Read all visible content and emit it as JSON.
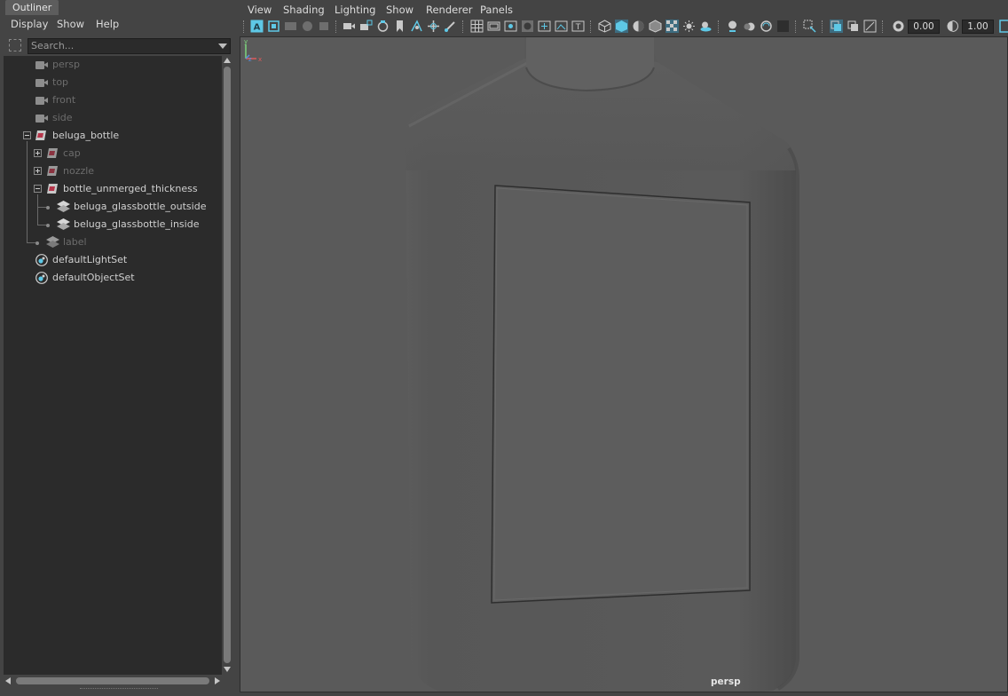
{
  "outliner": {
    "tab_title": "Outliner",
    "menu": {
      "display": "Display",
      "show": "Show",
      "help": "Help"
    },
    "search": {
      "placeholder": "Search..."
    },
    "items": [
      {
        "label": "persp",
        "type": "camera",
        "dim": true
      },
      {
        "label": "top",
        "type": "camera",
        "dim": true
      },
      {
        "label": "front",
        "type": "camera",
        "dim": true
      },
      {
        "label": "side",
        "type": "camera",
        "dim": true
      },
      {
        "label": "beluga_bottle",
        "type": "transform",
        "dim": false,
        "expanded": true
      },
      {
        "label": "cap",
        "type": "transform",
        "dim": true,
        "expanded": false
      },
      {
        "label": "nozzle",
        "type": "transform",
        "dim": true,
        "expanded": false
      },
      {
        "label": "bottle_unmerged_thickness",
        "type": "transform",
        "dim": false,
        "expanded": true
      },
      {
        "label": "beluga_glassbottle_outside",
        "type": "mesh",
        "dim": false
      },
      {
        "label": "beluga_glassbottle_inside",
        "type": "mesh",
        "dim": false
      },
      {
        "label": "label",
        "type": "mesh",
        "dim": true
      },
      {
        "label": "defaultLightSet",
        "type": "set",
        "dim": false
      },
      {
        "label": "defaultObjectSet",
        "type": "set",
        "dim": false
      }
    ]
  },
  "viewport": {
    "menu": {
      "view": "View",
      "shading": "Shading",
      "lighting": "Lighting",
      "show": "Show",
      "renderer": "Renderer",
      "panels": "Panels"
    },
    "toolbar": {
      "exposure": "0.00",
      "gamma": "1.00"
    },
    "camera_label": "persp",
    "axis": {
      "x": "x",
      "y": "y",
      "z": "z"
    },
    "colors": {
      "accent": "#5ec8e6",
      "background": "#5a5a5a"
    }
  }
}
